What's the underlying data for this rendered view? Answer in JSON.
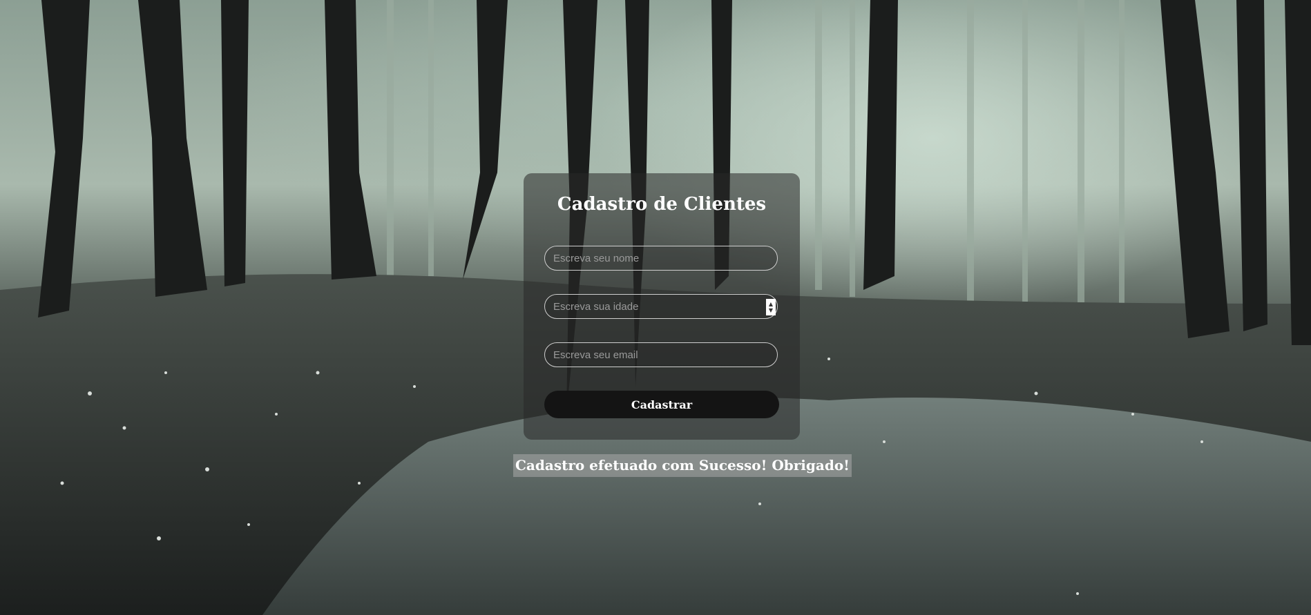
{
  "form": {
    "title": "Cadastro de Clientes",
    "name_placeholder": "Escreva seu nome",
    "age_placeholder": "Escreva sua idade",
    "email_placeholder": "Escreva seu email",
    "submit_label": "Cadastrar"
  },
  "message": {
    "success": "Cadastro efetuado com Sucesso! Obrigado!"
  },
  "icons": {
    "spinner": "number-spinner-icon"
  },
  "colors": {
    "button": "#141414",
    "text": "#ffffff",
    "card": "rgba(40,40,40,0.55)"
  }
}
